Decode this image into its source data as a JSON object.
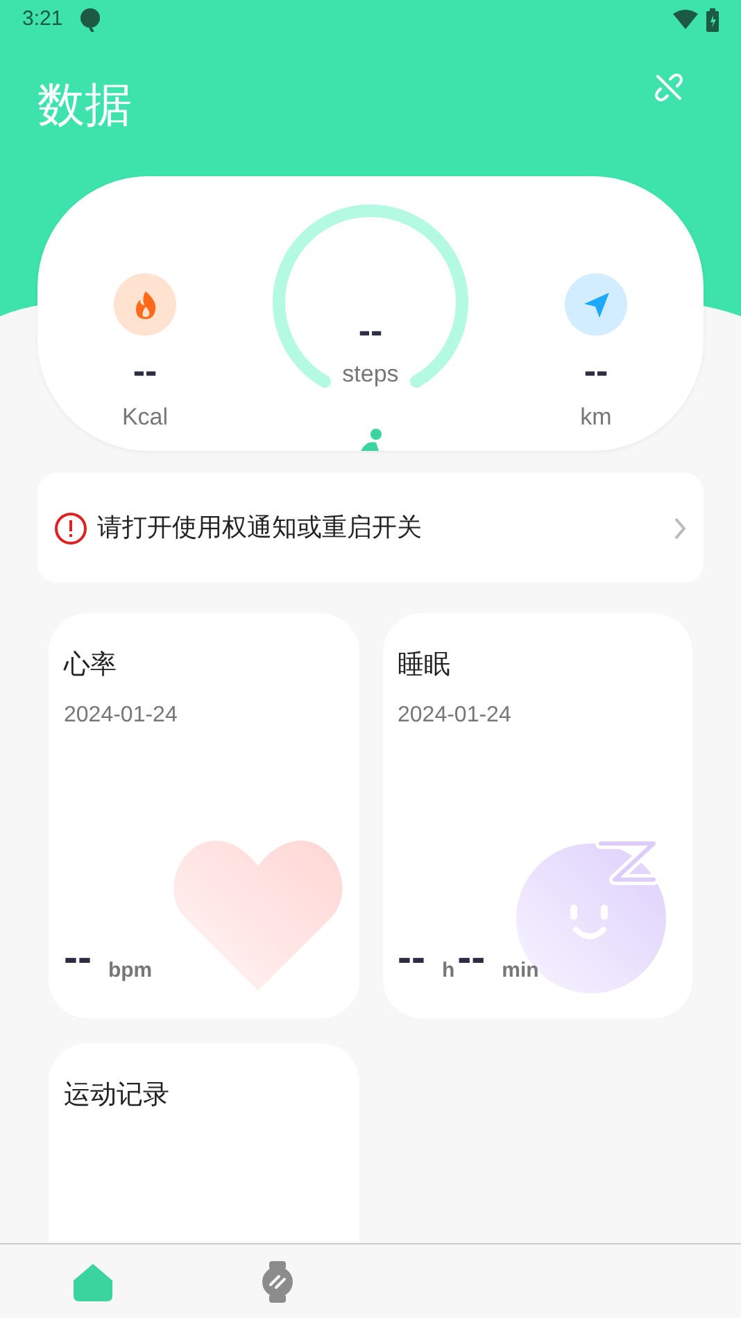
{
  "status_bar": {
    "time": "3:21"
  },
  "header": {
    "title": "数据"
  },
  "summary": {
    "steps": {
      "value": "--",
      "unit": "steps"
    },
    "calories": {
      "value": "--",
      "unit": "Kcal"
    },
    "distance": {
      "value": "--",
      "unit": "km"
    }
  },
  "notice": {
    "text": "请打开使用权通知或重启开关"
  },
  "cards": [
    {
      "kind": "heart",
      "title": "心率",
      "date": "2024-01-24",
      "parts": [
        {
          "value": "--",
          "unit": "bpm"
        }
      ]
    },
    {
      "kind": "sleep",
      "title": "睡眠",
      "date": "2024-01-24",
      "parts": [
        {
          "value": "--",
          "unit": "h"
        },
        {
          "value": "--",
          "unit": "min"
        }
      ]
    },
    {
      "kind": "exercise",
      "title": "运动记录"
    }
  ],
  "bottom_nav": [
    {
      "kind": "home",
      "selected": true
    },
    {
      "kind": "watch",
      "selected": false
    }
  ]
}
